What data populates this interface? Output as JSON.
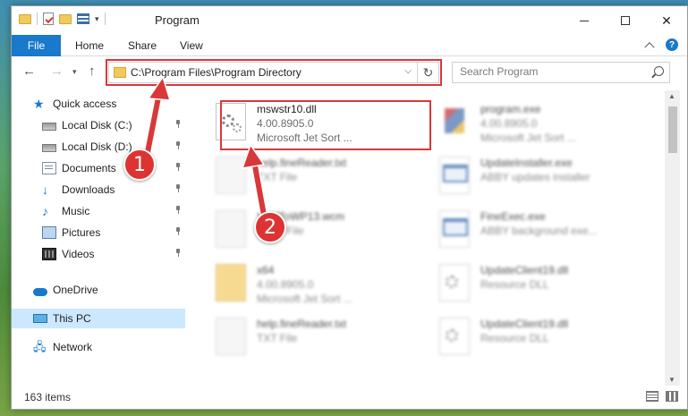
{
  "window": {
    "title": "Program",
    "controls": {
      "minimize": "—",
      "maximize": "",
      "close": "✕"
    }
  },
  "ribbon": {
    "tabs": [
      "File",
      "Home",
      "Share",
      "View"
    ]
  },
  "nav": {
    "back": "←",
    "forward": "→",
    "recent": "⌄",
    "up": "↑",
    "address": "C:\\Program Files\\Program Directory",
    "address_dropdown": "⌄",
    "refresh": "↻",
    "search_placeholder": "Search Program"
  },
  "sidebar": {
    "items": [
      {
        "label": "Quick access",
        "icon": "star-icon",
        "pinned": false
      },
      {
        "label": "Local Disk (C:)",
        "icon": "disk-icon",
        "pinned": true
      },
      {
        "label": "Local Disk (D:)",
        "icon": "disk-icon",
        "pinned": true
      },
      {
        "label": "Documents",
        "icon": "documents-icon",
        "pinned": true
      },
      {
        "label": "Downloads",
        "icon": "download-icon",
        "pinned": true
      },
      {
        "label": "Music",
        "icon": "music-icon",
        "pinned": true
      },
      {
        "label": "Pictures",
        "icon": "pictures-icon",
        "pinned": true
      },
      {
        "label": "Videos",
        "icon": "videos-icon",
        "pinned": true
      },
      {
        "label": "OneDrive",
        "icon": "cloud-icon",
        "pinned": false
      },
      {
        "label": "This PC",
        "icon": "pc-icon",
        "pinned": false,
        "selected": true
      },
      {
        "label": "Network",
        "icon": "network-icon",
        "pinned": false
      }
    ]
  },
  "files": [
    {
      "name": "mswstr10.dll",
      "line2": "4.00.8905.0",
      "line3": "Microsoft Jet Sort ...",
      "icon": "dll-icon",
      "highlighted": true
    },
    {
      "name": "program.exe",
      "line2": "4.00.8905.0",
      "line3": "Microsoft Jet Sort ...",
      "icon": "program-icon"
    },
    {
      "name": "help.fineReader.txt",
      "line2": "TXT File",
      "line3": "",
      "icon": "text-file-icon"
    },
    {
      "name": "UpdateInstaller.exe",
      "line2": "ABBY updates installer",
      "line3": "",
      "icon": "exe-icon"
    },
    {
      "name": "SLMToWP13.wcm",
      "line2": "WCM File",
      "line3": "",
      "icon": "text-file-icon"
    },
    {
      "name": "FineExec.exe",
      "line2": "ABBY background exe...",
      "line3": "",
      "icon": "exe-icon"
    },
    {
      "name": "x64",
      "line2": "4.00.8905.0",
      "line3": "Microsoft Jet Sort ...",
      "icon": "folder-icon"
    },
    {
      "name": "UpdateClient19.dll",
      "line2": "Resource DLL",
      "line3": "",
      "icon": "dll-icon"
    },
    {
      "name": "help.fineReader.txt",
      "line2": "TXT File",
      "line3": "",
      "icon": "text-file-icon"
    },
    {
      "name": "UpdateClient19.dll",
      "line2": "Resource DLL",
      "line3": "",
      "icon": "dll-icon"
    }
  ],
  "status": {
    "item_count": "163 items"
  },
  "annotations": {
    "step1": "1",
    "step2": "2",
    "highlight_color": "#d9383a"
  },
  "colors": {
    "accent": "#1979ca",
    "selection": "#cce8ff"
  }
}
